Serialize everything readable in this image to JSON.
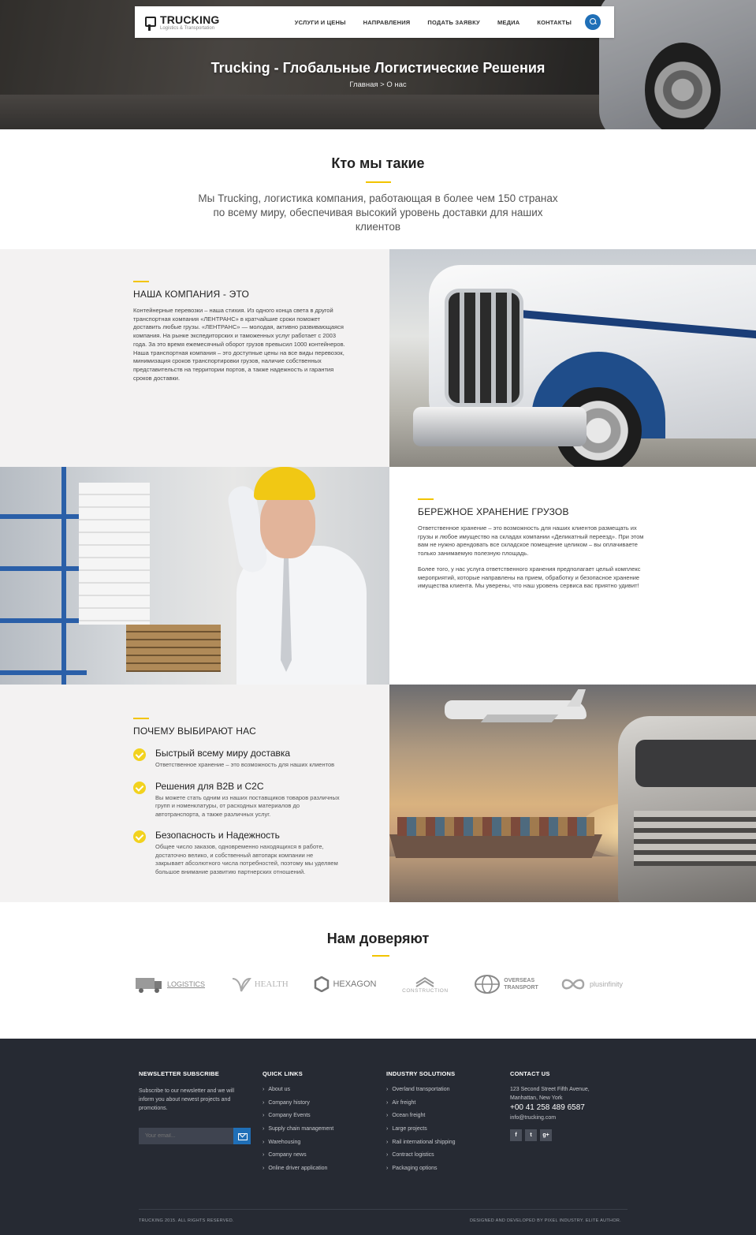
{
  "nav": {
    "logo_name": "TRUCKING",
    "logo_sub": "Logistics & Transportation",
    "items": [
      "УСЛУГИ И ЦЕНЫ",
      "НАПРАВЛЕНИЯ",
      "ПОДАТЬ ЗАЯВКУ",
      "МЕДИА",
      "КОНТАКТЫ"
    ],
    "search_icon": "search-icon"
  },
  "hero": {
    "title": "Trucking - Глобальные Логистические Решения",
    "breadcrumb": "Главная > О нас"
  },
  "about": {
    "title": "Кто мы такие",
    "text": "Мы Trucking, логистика компания, работающая в более чем 150 странах по всему миру, обеспечивая высокий уровень доставки для наших клиентов"
  },
  "company": {
    "title": "НАША КОМПАНИЯ - ЭТО",
    "text": "Контейнерные перевозки – наша стихия. Из одного конца света в другой транспортная компания «ЛЕНТРАНС» в кратчайшие сроки поможет доставить любые грузы. «ЛЕНТРАНС» — молодая, активно развивающаяся компания. На рынке экспедиторских и таможенных услуг работает с 2003 года. За это время ежемесячный оборот грузов превысил 1000 контейнеров. Наша транспортная компания – это доступные цены на все виды перевозок, минимизация сроков транспортировки грузов, наличие собственных представительств на территории портов, а также надежность и гарантия сроков доставки."
  },
  "storage": {
    "title": "БЕРЕЖНОЕ ХРАНЕНИЕ ГРУЗОВ",
    "text1": "Ответственное хранение – это возможность для наших клиентов размещать их грузы и любое имущество на складах компании «Деликатный переезд». При этом вам не нужно арендовать все складское помещение целиком – вы оплачиваете только занимаемую полезную площадь.",
    "text2": "Более того, у нас услуга ответственного хранения предполагает целый комплекс мероприятий, которые направлены на прием, обработку и безопасное хранение имущества клиента. Мы уверены, что наш уровень сервиса вас приятно удивит!"
  },
  "why": {
    "title": "ПОЧЕМУ ВЫБИРАЮТ НАС",
    "items": [
      {
        "title": "Быстрый всему миру доставка",
        "text": "Ответственное хранение – это возможность для наших клиентов"
      },
      {
        "title": "Решения для B2B и C2C",
        "text": "Вы можете стать одним из наших поставщиков товаров различных групп и номенклатуры, от расходных материалов до автотранспорта, а также различных услуг."
      },
      {
        "title": "Безопасность и Надежность",
        "text": "Общее число заказов, одновременно находящихся в работе, достаточно велико, и собственный автопарк компании не закрывает абсолютного числа потребностей, поэтому мы уделяем большое внимание развитию партнерских отношений."
      }
    ]
  },
  "partners": {
    "title": "Нам доверяют",
    "logos": [
      "LOGISTICS",
      "HEALTH",
      "HEXAGON",
      "CONSTRUCTION",
      "OVERSEAS TRANSPORT",
      "plusinfinity"
    ]
  },
  "footer": {
    "newsletter": {
      "title": "NEWSLETTER SUBSCRIBE",
      "text": "Subscribe to our newsletter and we will inform you about newest projects and promotions.",
      "placeholder": "Your email..."
    },
    "quick_links": {
      "title": "QUICK LINKS",
      "items": [
        "About us",
        "Company history",
        "Company Events",
        "Supply chain management",
        "Warehousing",
        "Company news",
        "Online driver application"
      ]
    },
    "industry": {
      "title": "INDUSTRY SOLUTIONS",
      "items": [
        "Overland transportation",
        "Air freight",
        "Ocean freight",
        "Large projects",
        "Rail international shipping",
        "Contract logistics",
        "Packaging options"
      ]
    },
    "contact": {
      "title": "CONTACT US",
      "address1": "123 Second Street Fifth Avenue,",
      "address2": "Manhattan, New York",
      "phone": "+00 41 258 489 6587",
      "email": "info@trucking.com",
      "socials": [
        "f",
        "t",
        "g+"
      ]
    },
    "copyright": "TRUCKING 2015. ALL RIGHTS RESERVED.",
    "developer": "DESIGNED AND DEVELOPED BY PIXEL INDUSTRY. ELITE AUTHOR."
  }
}
